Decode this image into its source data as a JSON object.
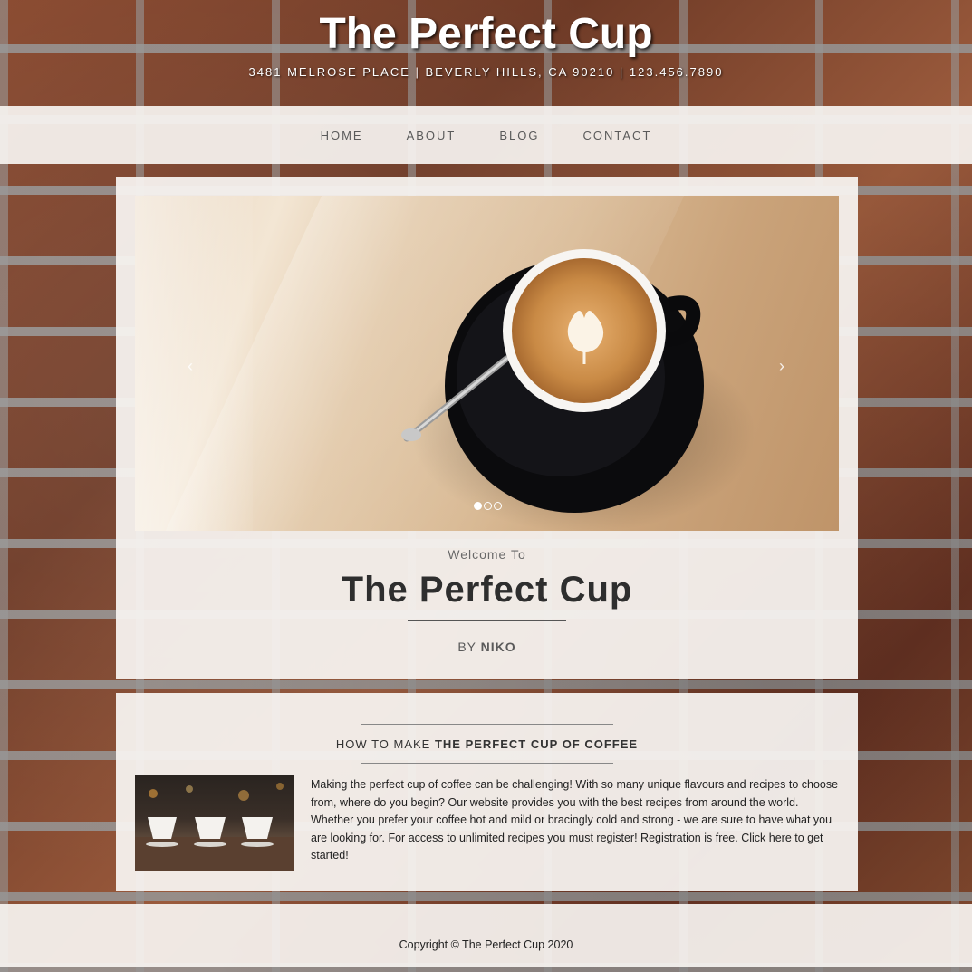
{
  "header": {
    "title": "The Perfect Cup",
    "address": "3481 MELROSE PLACE | BEVERLY HILLS, CA 90210 | 123.456.7890"
  },
  "nav": {
    "items": [
      "HOME",
      "ABOUT",
      "BLOG",
      "CONTACT"
    ]
  },
  "carousel": {
    "prev_arrow": "‹",
    "next_arrow": "›",
    "slide_count": 3,
    "active_slide": 1
  },
  "hero": {
    "welcome": "Welcome To",
    "title": "The Perfect Cup",
    "by_prefix": "BY",
    "by_author": "NIKO"
  },
  "intro": {
    "heading_prefix": "HOW TO MAKE",
    "heading_strong": "THE PERFECT CUP OF COFFEE",
    "paragraph": "Making the perfect cup of coffee can be challenging! With so many unique flavours and recipes to choose from, where do you begin? Our website provides you with the best recipes from around the world. Whether you prefer your coffee hot and mild or bracingly cold and strong - we are sure to have what you are looking for. For access to unlimited recipes you must register! Registration is free. Click here to get started!"
  },
  "footer": {
    "copyright": "Copyright © The Perfect Cup 2020"
  },
  "colors": {
    "panel_bg": "#f6f3f0",
    "nav_text": "#5a5a5a",
    "title_white": "#ffffff",
    "hero_title": "#2e2e2e"
  }
}
